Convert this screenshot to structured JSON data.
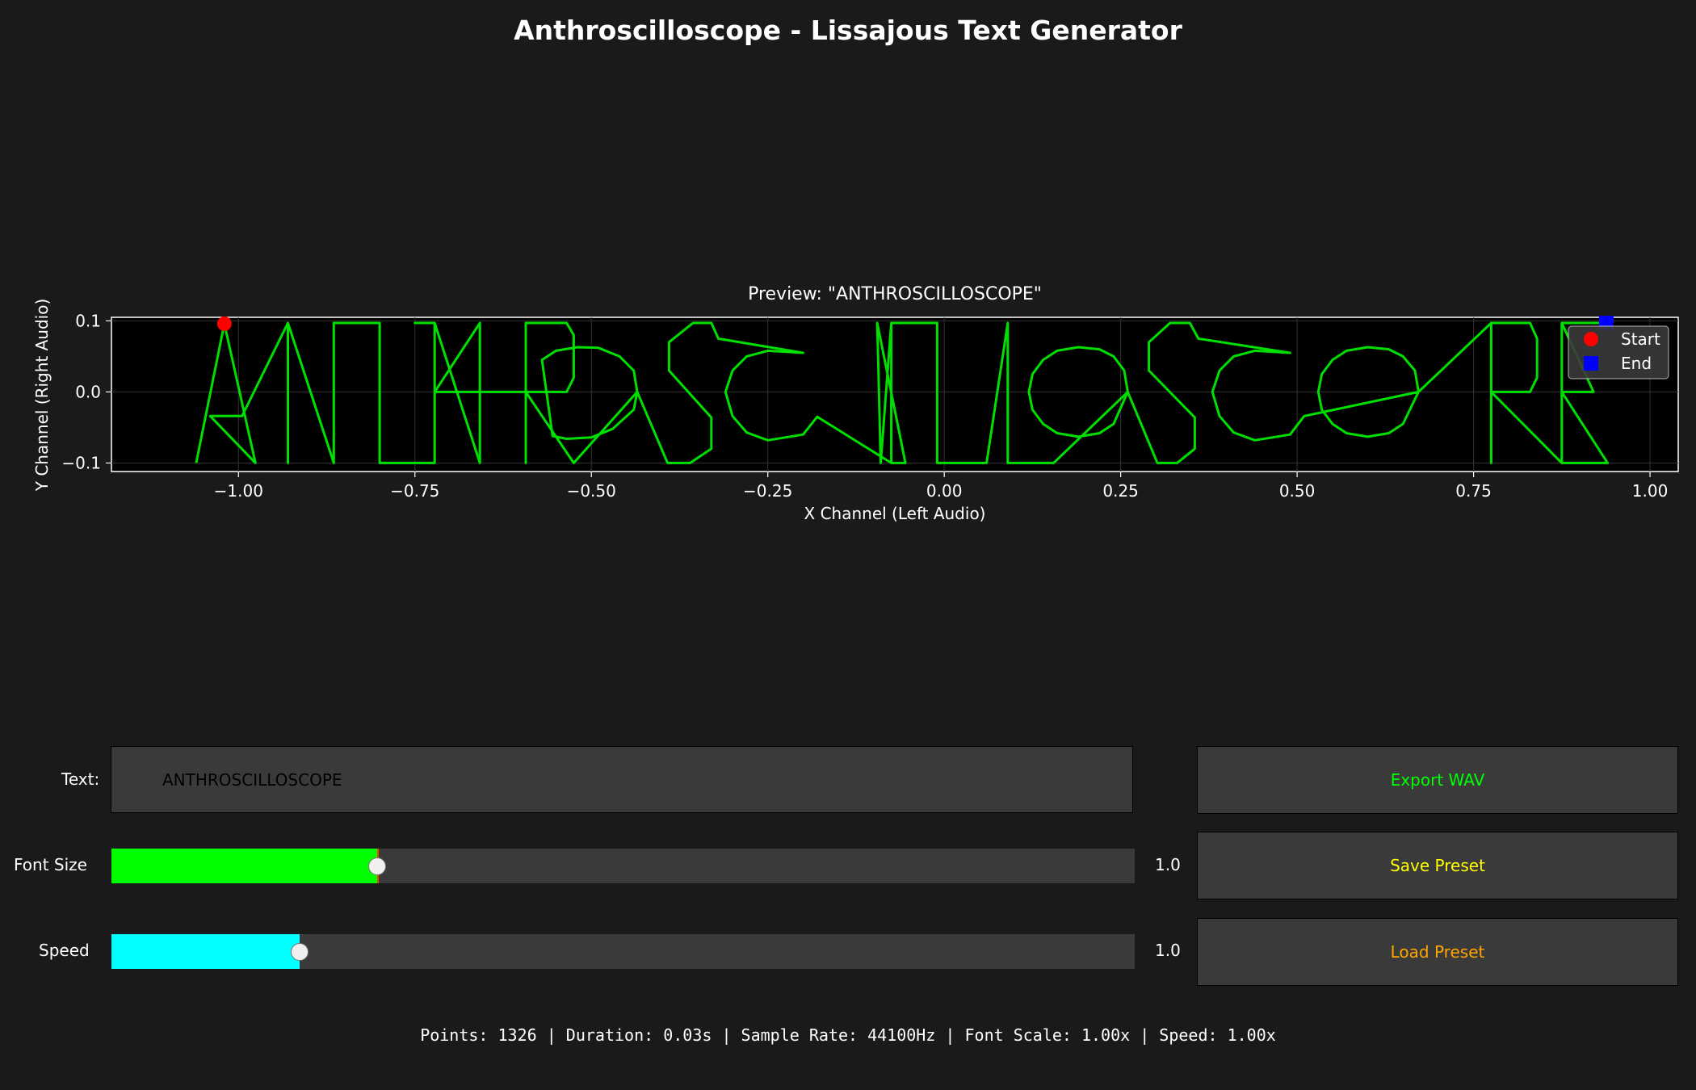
{
  "app": {
    "title": "Anthroscilloscope - Lissajous Text Generator"
  },
  "chart_data": {
    "type": "line",
    "title": "Preview: \"ANTHROSCILLOSCOPE\"",
    "xlabel": "X Channel (Left Audio)",
    "ylabel": "Y Channel (Right Audio)",
    "xlim": [
      -1.18,
      1.04
    ],
    "ylim": [
      -0.112,
      0.105
    ],
    "xticks": [
      -1.0,
      -0.75,
      -0.5,
      -0.25,
      0.0,
      0.25,
      0.5,
      0.75,
      1.0
    ],
    "xtick_labels": [
      "−1.00",
      "−0.75",
      "−0.50",
      "−0.25",
      "0.00",
      "0.25",
      "0.50",
      "0.75",
      "1.00"
    ],
    "yticks": [
      0.1,
      0.0,
      -0.1
    ],
    "ytick_labels": [
      "0.1",
      "0.0",
      "−0.1"
    ],
    "grid": true,
    "legend_placement": "top-right",
    "trace_color": "#00e000",
    "series": [
      {
        "name": "Start",
        "marker": "circle",
        "color": "#ff0000",
        "points": [
          [
            -1.02,
            0.096
          ]
        ]
      },
      {
        "name": "End",
        "marker": "square",
        "color": "#0000ff",
        "points": [
          [
            0.938,
            0.097
          ]
        ]
      }
    ],
    "trace": [
      [
        -1.06,
        -0.1
      ],
      [
        -1.02,
        0.096
      ],
      [
        -0.976,
        -0.1
      ],
      [
        -1.04,
        -0.034
      ],
      [
        -0.995,
        -0.034
      ],
      [
        -0.93,
        0.097
      ],
      [
        -0.93,
        -0.1
      ],
      [
        -0.93,
        0.097
      ],
      [
        -0.865,
        -0.1
      ],
      [
        -0.865,
        0.097
      ],
      [
        -0.8,
        0.097
      ],
      [
        -0.8,
        -0.1
      ],
      [
        -0.722,
        -0.1
      ],
      [
        -0.722,
        0.097
      ],
      [
        -0.75,
        0.097
      ],
      [
        -0.722,
        0.097
      ],
      [
        -0.658,
        -0.1
      ],
      [
        -0.658,
        0.097
      ],
      [
        -0.722,
        0.0
      ],
      [
        -0.658,
        0.0
      ],
      [
        -0.593,
        0.0
      ],
      [
        -0.593,
        -0.1
      ],
      [
        -0.593,
        0.097
      ],
      [
        -0.535,
        0.097
      ],
      [
        -0.525,
        0.08
      ],
      [
        -0.525,
        0.02
      ],
      [
        -0.535,
        0.0
      ],
      [
        -0.593,
        0.0
      ],
      [
        -0.525,
        -0.1
      ],
      [
        -0.435,
        0.0
      ],
      [
        -0.44,
        0.03
      ],
      [
        -0.46,
        0.05
      ],
      [
        -0.49,
        0.062
      ],
      [
        -0.52,
        0.063
      ],
      [
        -0.55,
        0.058
      ],
      [
        -0.57,
        0.045
      ],
      [
        -0.555,
        -0.062
      ],
      [
        -0.535,
        -0.066
      ],
      [
        -0.5,
        -0.064
      ],
      [
        -0.47,
        -0.052
      ],
      [
        -0.44,
        -0.025
      ],
      [
        -0.435,
        0.0
      ],
      [
        -0.392,
        -0.1
      ],
      [
        -0.36,
        -0.1
      ],
      [
        -0.33,
        -0.08
      ],
      [
        -0.33,
        -0.036
      ],
      [
        -0.39,
        0.03
      ],
      [
        -0.39,
        0.07
      ],
      [
        -0.356,
        0.097
      ],
      [
        -0.33,
        0.097
      ],
      [
        -0.32,
        0.075
      ],
      [
        -0.2,
        0.055
      ],
      [
        -0.25,
        0.058
      ],
      [
        -0.28,
        0.05
      ],
      [
        -0.3,
        0.03
      ],
      [
        -0.31,
        0.0
      ],
      [
        -0.3,
        -0.034
      ],
      [
        -0.28,
        -0.057
      ],
      [
        -0.25,
        -0.068
      ],
      [
        -0.2,
        -0.06
      ],
      [
        -0.18,
        -0.035
      ],
      [
        -0.075,
        -0.1
      ],
      [
        -0.075,
        0.097
      ],
      [
        -0.09,
        -0.1
      ],
      [
        -0.095,
        0.097
      ],
      [
        -0.055,
        -0.1
      ],
      [
        -0.075,
        -0.1
      ],
      [
        -0.075,
        0.097
      ],
      [
        -0.01,
        0.097
      ],
      [
        -0.01,
        -0.1
      ],
      [
        0.06,
        -0.1
      ],
      [
        0.09,
        0.097
      ],
      [
        0.09,
        -0.1
      ],
      [
        0.155,
        -0.1
      ],
      [
        0.26,
        0.0
      ],
      [
        0.255,
        0.03
      ],
      [
        0.24,
        0.05
      ],
      [
        0.22,
        0.06
      ],
      [
        0.19,
        0.063
      ],
      [
        0.16,
        0.058
      ],
      [
        0.14,
        0.045
      ],
      [
        0.125,
        0.025
      ],
      [
        0.12,
        0.0
      ],
      [
        0.125,
        -0.025
      ],
      [
        0.14,
        -0.045
      ],
      [
        0.16,
        -0.058
      ],
      [
        0.19,
        -0.063
      ],
      [
        0.22,
        -0.058
      ],
      [
        0.24,
        -0.045
      ],
      [
        0.26,
        0.0
      ],
      [
        0.302,
        -0.1
      ],
      [
        0.33,
        -0.1
      ],
      [
        0.355,
        -0.08
      ],
      [
        0.355,
        -0.036
      ],
      [
        0.29,
        0.03
      ],
      [
        0.29,
        0.07
      ],
      [
        0.32,
        0.097
      ],
      [
        0.348,
        0.097
      ],
      [
        0.36,
        0.075
      ],
      [
        0.49,
        0.055
      ],
      [
        0.44,
        0.058
      ],
      [
        0.41,
        0.05
      ],
      [
        0.39,
        0.03
      ],
      [
        0.38,
        0.0
      ],
      [
        0.39,
        -0.034
      ],
      [
        0.41,
        -0.057
      ],
      [
        0.44,
        -0.068
      ],
      [
        0.49,
        -0.06
      ],
      [
        0.51,
        -0.034
      ],
      [
        0.672,
        0.0
      ],
      [
        0.667,
        0.03
      ],
      [
        0.65,
        0.05
      ],
      [
        0.63,
        0.06
      ],
      [
        0.6,
        0.063
      ],
      [
        0.57,
        0.058
      ],
      [
        0.55,
        0.045
      ],
      [
        0.535,
        0.025
      ],
      [
        0.53,
        0.0
      ],
      [
        0.535,
        -0.025
      ],
      [
        0.55,
        -0.045
      ],
      [
        0.57,
        -0.058
      ],
      [
        0.6,
        -0.063
      ],
      [
        0.63,
        -0.058
      ],
      [
        0.65,
        -0.045
      ],
      [
        0.672,
        0.0
      ],
      [
        0.775,
        0.097
      ],
      [
        0.775,
        -0.1
      ],
      [
        0.775,
        0.097
      ],
      [
        0.83,
        0.097
      ],
      [
        0.84,
        0.075
      ],
      [
        0.84,
        0.02
      ],
      [
        0.83,
        0.0
      ],
      [
        0.775,
        0.0
      ],
      [
        0.875,
        -0.1
      ],
      [
        0.94,
        -0.1
      ],
      [
        0.875,
        0.0
      ],
      [
        0.92,
        0.0
      ],
      [
        0.875,
        0.097
      ],
      [
        0.875,
        -0.1
      ],
      [
        0.875,
        0.097
      ],
      [
        0.938,
        0.097
      ]
    ]
  },
  "controls": {
    "text_label": "Text:",
    "text_value": "ANTHROSCILLOSCOPE",
    "font_size_label": "Font Size",
    "font_size_value": "1.0",
    "font_size_fill_fraction": 0.26,
    "font_size_color": "#00ff00",
    "speed_label": "Speed",
    "speed_value": "1.0",
    "speed_fill_fraction": 0.184,
    "speed_color": "#00ffff"
  },
  "buttons": {
    "export_label": "Export WAV",
    "export_color": "#00ff00",
    "save_label": "Save Preset",
    "save_color": "#ffff00",
    "load_label": "Load Preset",
    "load_color": "#ffa500"
  },
  "status": "Points: 1326 | Duration: 0.03s | Sample Rate: 44100Hz | Font Scale: 1.00x | Speed: 1.00x"
}
